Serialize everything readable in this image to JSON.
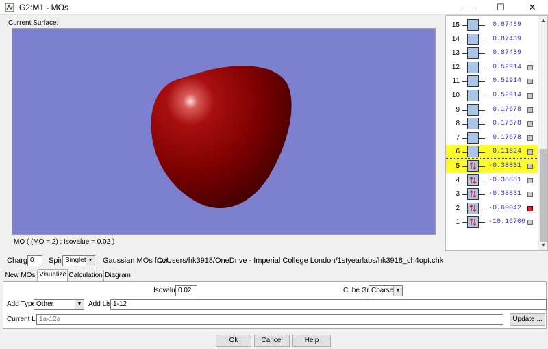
{
  "window": {
    "title": "G2:M1 - MOs",
    "minimize": "—",
    "maximize": "☐",
    "close": "✕"
  },
  "surface": {
    "label": "Current Surface:",
    "status": "MO ( (MO = 2) ; Isovalue = 0.02 )",
    "bg_color": "#7d7fcf",
    "lobe_color": "#8b0000"
  },
  "orbitals": [
    {
      "num": "15",
      "energy": "0.87439",
      "occupied": false,
      "highlight": false,
      "checkbox": false
    },
    {
      "num": "14",
      "energy": "0.87439",
      "occupied": false,
      "highlight": false,
      "checkbox": false
    },
    {
      "num": "13",
      "energy": "0.87439",
      "occupied": false,
      "highlight": false,
      "checkbox": false
    },
    {
      "num": "12",
      "energy": "0.52914",
      "occupied": false,
      "highlight": false,
      "checkbox": true
    },
    {
      "num": "11",
      "energy": "0.52914",
      "occupied": false,
      "highlight": false,
      "checkbox": true
    },
    {
      "num": "10",
      "energy": "0.52914",
      "occupied": false,
      "highlight": false,
      "checkbox": true
    },
    {
      "num": "9",
      "energy": "0.17678",
      "occupied": false,
      "highlight": false,
      "checkbox": true
    },
    {
      "num": "8",
      "energy": "0.17678",
      "occupied": false,
      "highlight": false,
      "checkbox": true
    },
    {
      "num": "7",
      "energy": "0.17678",
      "occupied": false,
      "highlight": false,
      "checkbox": true
    },
    {
      "num": "6",
      "energy": "0.11824",
      "occupied": false,
      "highlight": true,
      "checkbox": true
    },
    {
      "num": "5",
      "energy": "-0.38831",
      "occupied": true,
      "highlight": true,
      "checkbox": true
    },
    {
      "num": "4",
      "energy": "-0.38831",
      "occupied": true,
      "highlight": false,
      "checkbox": true
    },
    {
      "num": "3",
      "energy": "-0.38831",
      "occupied": true,
      "highlight": false,
      "checkbox": true
    },
    {
      "num": "2",
      "energy": "-0.69042",
      "occupied": true,
      "highlight": false,
      "checkbox": true,
      "checked": true
    },
    {
      "num": "1",
      "energy": "-10.16706",
      "occupied": true,
      "highlight": false,
      "checkbox": true
    }
  ],
  "info": {
    "charge_label": "Charge:",
    "charge_value": "0",
    "spin_label": "Spin:",
    "spin_value": "Singlet",
    "source_label": "Gaussian MOs from:",
    "source_path": "C:/Users/hk3918/OneDrive - Imperial College London/1styearlabs/hk3918_ch4opt.chk"
  },
  "tabs": [
    "New MOs",
    "Visualize",
    "Calculation",
    "Diagram"
  ],
  "visualize": {
    "isovalue_label": "Isovalue:",
    "isovalue": "0.02",
    "cube_label": "Cube Grid:",
    "cube_value": "Coarse",
    "add_type_label": "Add Type:",
    "add_type_value": "Other",
    "add_list_label": "Add List:",
    "add_list_value": "1-12",
    "current_list_label": "Current List:",
    "current_list_value": "1a-12a",
    "update_label": "Update ..."
  },
  "buttons": {
    "ok": "Ok",
    "cancel": "Cancel",
    "help": "Help"
  }
}
